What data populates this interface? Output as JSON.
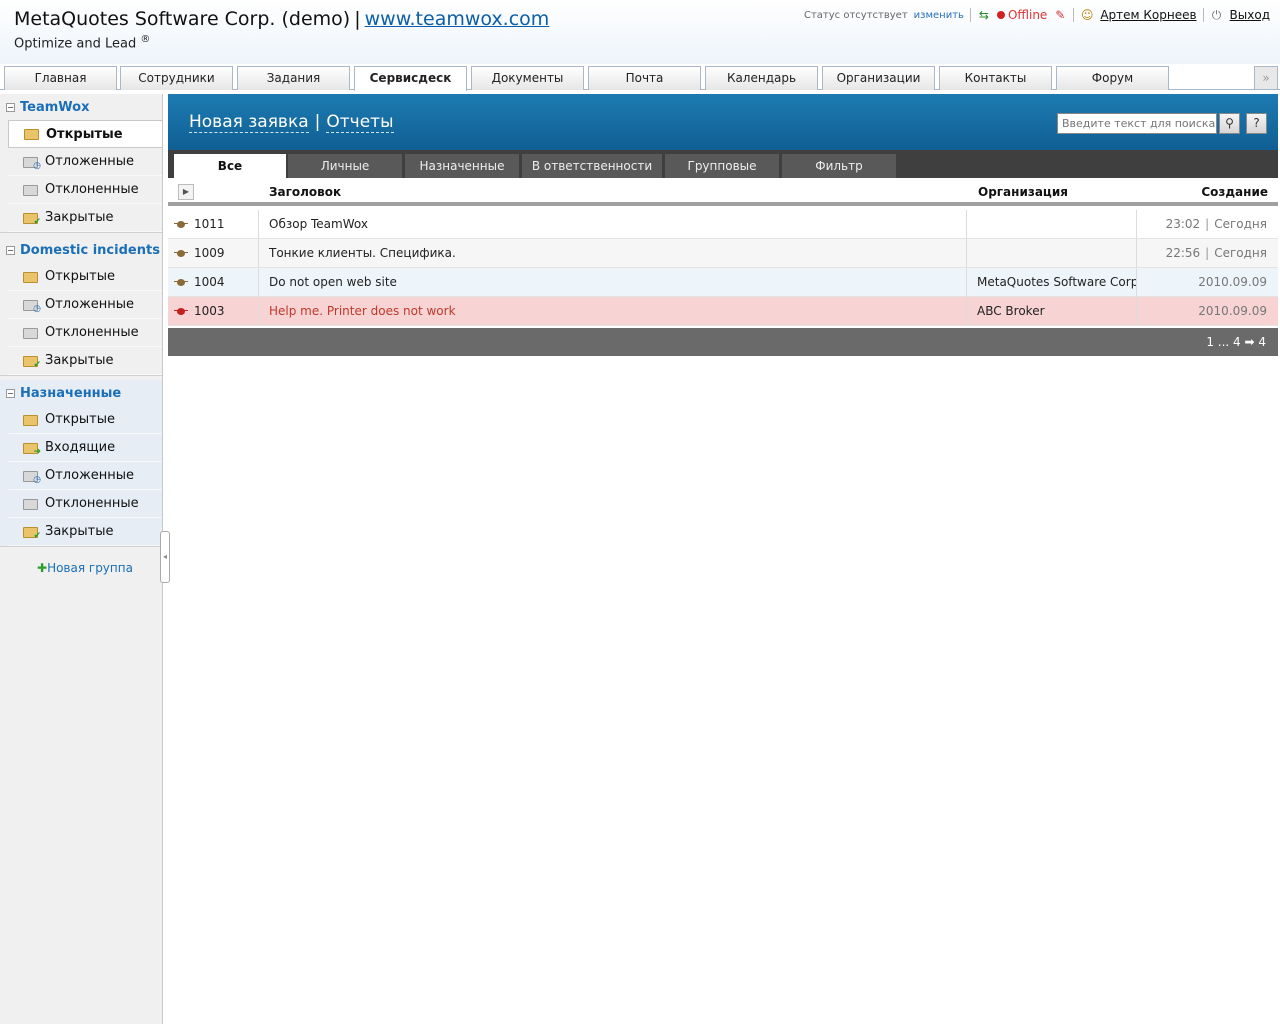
{
  "header": {
    "company": "MetaQuotes Software Corp. (demo)",
    "separator": "|",
    "site_link": "www.teamwox.com",
    "slogan": "Optimize and Lead",
    "slogan_mark": "®",
    "status_text": "Статус отсутствует",
    "status_change": "изменить",
    "offline": "Offline",
    "user": "Артем Корнеев",
    "logout": "Выход"
  },
  "top_tabs": [
    {
      "label": "Главная"
    },
    {
      "label": "Сотрудники"
    },
    {
      "label": "Задания"
    },
    {
      "label": "Сервисдеск"
    },
    {
      "label": "Документы"
    },
    {
      "label": "Почта"
    },
    {
      "label": "Календарь"
    },
    {
      "label": "Организации"
    },
    {
      "label": "Контакты"
    },
    {
      "label": "Форум"
    }
  ],
  "top_tabs_active": "Сервисдеск",
  "tabs_more": "»",
  "sidebar": {
    "groups": [
      {
        "title": "TeamWox",
        "items": [
          {
            "label": "Открытые",
            "icon": "folder-open-icon"
          },
          {
            "label": "Отложенные",
            "icon": "folder-clock-icon"
          },
          {
            "label": "Отклоненные",
            "icon": "folder-rejected-icon"
          },
          {
            "label": "Закрытые",
            "icon": "folder-check-icon"
          }
        ]
      },
      {
        "title": "Domestic incidents",
        "items": [
          {
            "label": "Открытые",
            "icon": "folder-open-icon"
          },
          {
            "label": "Отложенные",
            "icon": "folder-clock-icon"
          },
          {
            "label": "Отклоненные",
            "icon": "folder-rejected-icon"
          },
          {
            "label": "Закрытые",
            "icon": "folder-check-icon"
          }
        ]
      },
      {
        "title": "Назначенные",
        "items": [
          {
            "label": "Открытые",
            "icon": "folder-open-icon"
          },
          {
            "label": "Входящие",
            "icon": "folder-incoming-icon"
          },
          {
            "label": "Отложенные",
            "icon": "folder-clock-icon"
          },
          {
            "label": "Отклоненные",
            "icon": "folder-rejected-icon"
          },
          {
            "label": "Закрытые",
            "icon": "folder-check-icon"
          }
        ]
      }
    ],
    "new_group": "Новая группа"
  },
  "banner": {
    "new_request": "Новая заявка",
    "bar": "|",
    "reports": "Отчеты",
    "search_placeholder": "Введите текст для поиска",
    "help": "?"
  },
  "sub_tabs": [
    {
      "label": "Все"
    },
    {
      "label": "Личные"
    },
    {
      "label": "Назначенные"
    },
    {
      "label": "В ответственности"
    },
    {
      "label": "Групповые"
    },
    {
      "label": "Фильтр"
    }
  ],
  "sub_tabs_active": "Все",
  "grid": {
    "columns": {
      "title": "Заголовок",
      "org": "Организация",
      "created": "Создание"
    },
    "rows": [
      {
        "id": "1011",
        "title": "Обзор TeamWox",
        "org": "",
        "time": "23:02",
        "date": "Сегодня",
        "priority": "normal"
      },
      {
        "id": "1009",
        "title": "Тонкие клиенты. Специфика.",
        "org": "",
        "time": "22:56",
        "date": "Сегодня",
        "priority": "normal"
      },
      {
        "id": "1004",
        "title": "Do not open web site",
        "org": "MetaQuotes Software Corp",
        "time": "",
        "date": "2010.09.09",
        "priority": "normal"
      },
      {
        "id": "1003",
        "title": "Help me. Printer does not work",
        "org": "ABC Broker",
        "time": "",
        "date": "2010.09.09",
        "priority": "high"
      }
    ],
    "pager": "1 ... 4 ➡ 4"
  },
  "colors": {
    "accent": "#1a6fb8",
    "banner": "#156b9f",
    "alert_row": "#f7d3d3",
    "offline": "#d02020"
  }
}
